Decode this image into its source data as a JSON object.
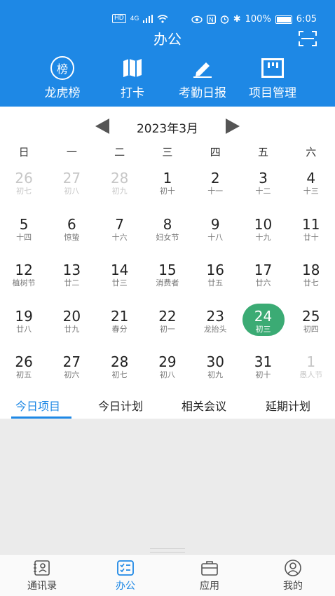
{
  "status_bar": {
    "network": "HD",
    "signal": "4G",
    "battery": "100%",
    "time": "6:05"
  },
  "header": {
    "title": "办公",
    "scan_icon": "scan-icon",
    "color": "#1e88e5"
  },
  "shortcuts": [
    {
      "label": "龙虎榜",
      "icon": "rank-badge-icon",
      "badge": "榜"
    },
    {
      "label": "打卡",
      "icon": "map-icon"
    },
    {
      "label": "考勤日报",
      "icon": "pencil-icon"
    },
    {
      "label": "项目管理",
      "icon": "board-icon"
    }
  ],
  "calendar": {
    "month_label": "2023年3月",
    "weekdays": [
      "日",
      "一",
      "二",
      "三",
      "四",
      "五",
      "六"
    ],
    "today_color": "#3bab74",
    "rows": [
      [
        {
          "d": "26",
          "l": "初七",
          "muted": true
        },
        {
          "d": "27",
          "l": "初八",
          "muted": true
        },
        {
          "d": "28",
          "l": "初九",
          "muted": true
        },
        {
          "d": "1",
          "l": "初十"
        },
        {
          "d": "2",
          "l": "十一"
        },
        {
          "d": "3",
          "l": "十二"
        },
        {
          "d": "4",
          "l": "十三"
        }
      ],
      [
        {
          "d": "5",
          "l": "十四"
        },
        {
          "d": "6",
          "l": "惊蛰"
        },
        {
          "d": "7",
          "l": "十六"
        },
        {
          "d": "8",
          "l": "妇女节"
        },
        {
          "d": "9",
          "l": "十八"
        },
        {
          "d": "10",
          "l": "十九"
        },
        {
          "d": "11",
          "l": "廿十"
        }
      ],
      [
        {
          "d": "12",
          "l": "植树节"
        },
        {
          "d": "13",
          "l": "廿二"
        },
        {
          "d": "14",
          "l": "廿三"
        },
        {
          "d": "15",
          "l": "消费者"
        },
        {
          "d": "16",
          "l": "廿五"
        },
        {
          "d": "17",
          "l": "廿六"
        },
        {
          "d": "18",
          "l": "廿七"
        }
      ],
      [
        {
          "d": "19",
          "l": "廿八"
        },
        {
          "d": "20",
          "l": "廿九"
        },
        {
          "d": "21",
          "l": "春分"
        },
        {
          "d": "22",
          "l": "初一"
        },
        {
          "d": "23",
          "l": "龙抬头"
        },
        {
          "d": "24",
          "l": "初三",
          "today": true
        },
        {
          "d": "25",
          "l": "初四"
        }
      ],
      [
        {
          "d": "26",
          "l": "初五"
        },
        {
          "d": "27",
          "l": "初六"
        },
        {
          "d": "28",
          "l": "初七"
        },
        {
          "d": "29",
          "l": "初八"
        },
        {
          "d": "30",
          "l": "初九"
        },
        {
          "d": "31",
          "l": "初十"
        },
        {
          "d": "1",
          "l": "愚人节",
          "muted": true
        }
      ]
    ]
  },
  "tabs": [
    {
      "label": "今日项目",
      "active": true
    },
    {
      "label": "今日计划"
    },
    {
      "label": "相关会议"
    },
    {
      "label": "延期计划"
    }
  ],
  "bottom_nav": [
    {
      "label": "通讯录",
      "icon": "contacts-icon"
    },
    {
      "label": "办公",
      "icon": "office-icon",
      "active": true
    },
    {
      "label": "应用",
      "icon": "briefcase-icon"
    },
    {
      "label": "我的",
      "icon": "user-icon"
    }
  ]
}
